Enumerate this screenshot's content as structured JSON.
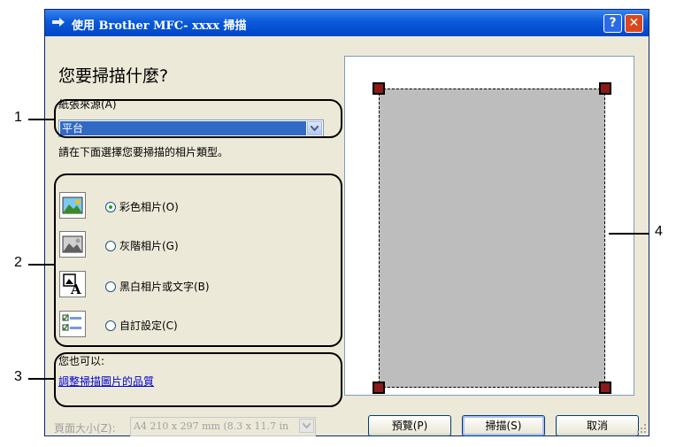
{
  "window": {
    "title": "使用 Brother MFC- xxxx 掃描",
    "help_label": "?",
    "close_label": "✕"
  },
  "main": {
    "heading": "您要掃描什麼?",
    "paper_source_label": "紙張來源(A)",
    "paper_source_value": "平台",
    "instruction": "請在下面選擇您要掃描的相片類型。",
    "photo_types": [
      {
        "label": "彩色相片(O)",
        "icon": "color-photo-icon",
        "selected": true
      },
      {
        "label": "灰階相片(G)",
        "icon": "grayscale-photo-icon",
        "selected": false
      },
      {
        "label": "黑白相片或文字(B)",
        "icon": "bw-text-icon",
        "selected": false
      },
      {
        "label": "自訂設定(C)",
        "icon": "custom-settings-icon",
        "selected": false
      }
    ],
    "also_label": "您也可以:",
    "adjust_link": "調整掃描圖片的品質",
    "page_size_label": "頁面大小(Z):",
    "page_size_value": "A4 210 x 297 mm (8.3 x 11.7 in"
  },
  "buttons": {
    "preview": "預覽(P)",
    "scan": "掃描(S)",
    "cancel": "取消"
  },
  "callouts": [
    "1",
    "2",
    "3",
    "4"
  ],
  "colors": {
    "titlebar": "#0a5ad8",
    "selection": "#316ac5",
    "link": "#0000cc",
    "dialog_bg": "#ece9d8",
    "handle": "#8b1a1a"
  }
}
